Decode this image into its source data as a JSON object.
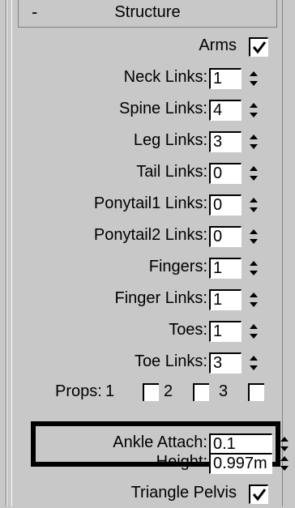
{
  "rollout": {
    "collapse_symbol": "-",
    "title": "Structure"
  },
  "arms": {
    "label": "Arms",
    "checked": true
  },
  "links": [
    {
      "label": "Neck Links:",
      "value": "1"
    },
    {
      "label": "Spine Links:",
      "value": "4"
    },
    {
      "label": "Leg Links:",
      "value": "3"
    },
    {
      "label": "Tail Links:",
      "value": "0"
    },
    {
      "label": "Ponytail1 Links:",
      "value": "0"
    },
    {
      "label": "Ponytail2 Links:",
      "value": "0"
    },
    {
      "label": "Fingers:",
      "value": "1"
    },
    {
      "label": "Finger Links:",
      "value": "1"
    },
    {
      "label": "Toes:",
      "value": "1"
    },
    {
      "label": "Toe Links:",
      "value": "3"
    }
  ],
  "props": {
    "label": "Props:",
    "items": [
      "1",
      "2",
      "3"
    ]
  },
  "ankle_attach": {
    "label": "Ankle Attach:",
    "value": "0.1"
  },
  "height": {
    "label": "Height:",
    "value": "0.997m"
  },
  "triangle_pelvis": {
    "label": "Triangle Pelvis",
    "checked": true
  }
}
